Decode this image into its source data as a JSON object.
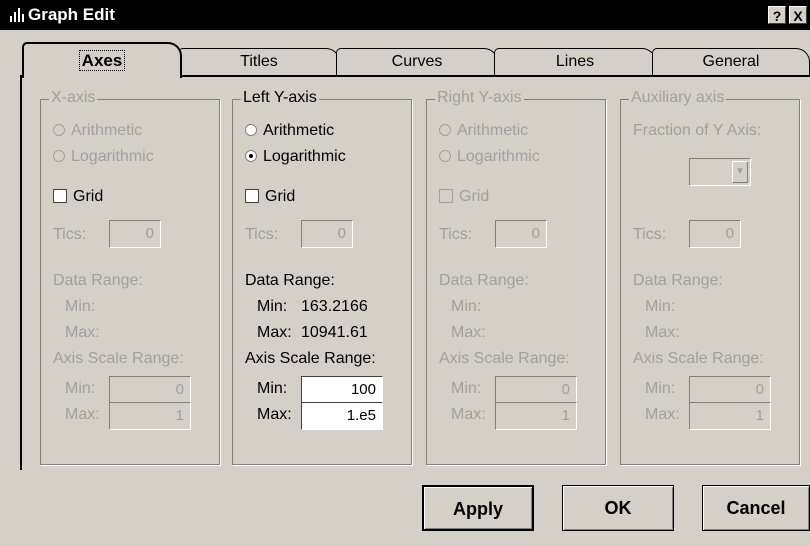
{
  "window": {
    "title": "Graph Edit",
    "help_label": "?",
    "close_label": "X"
  },
  "tabs": [
    {
      "label": "Axes",
      "active": true
    },
    {
      "label": "Titles"
    },
    {
      "label": "Curves"
    },
    {
      "label": "Lines"
    },
    {
      "label": "General"
    }
  ],
  "groups": {
    "x_axis": {
      "title": "X-axis",
      "arithmetic": "Arithmetic",
      "logarithmic": "Logarithmic",
      "grid": "Grid",
      "tics_label": "Tics:",
      "tics_value": "0",
      "data_range": "Data Range:",
      "min_label": "Min:",
      "max_label": "Max:",
      "scale_range": "Axis Scale Range:",
      "scale_min_label": "Min:",
      "scale_min": "0",
      "scale_max_label": "Max:",
      "scale_max": "1"
    },
    "left_y": {
      "title": "Left Y-axis",
      "arithmetic": "Arithmetic",
      "logarithmic": "Logarithmic",
      "grid": "Grid",
      "tics_label": "Tics:",
      "tics_value": "0",
      "data_range": "Data Range:",
      "min_label": "Min:",
      "min_value": "163.2166",
      "max_label": "Max:",
      "max_value": "10941.61",
      "scale_range": "Axis Scale Range:",
      "scale_min_label": "Min:",
      "scale_min": "100",
      "scale_max_label": "Max:",
      "scale_max": "1.e5"
    },
    "right_y": {
      "title": "Right Y-axis",
      "arithmetic": "Arithmetic",
      "logarithmic": "Logarithmic",
      "grid": "Grid",
      "tics_label": "Tics:",
      "tics_value": "0",
      "data_range": "Data Range:",
      "min_label": "Min:",
      "max_label": "Max:",
      "scale_range": "Axis Scale Range:",
      "scale_min_label": "Min:",
      "scale_min": "0",
      "scale_max_label": "Max:",
      "scale_max": "1"
    },
    "aux": {
      "title": "Auxiliary axis",
      "fraction_label": "Fraction of Y Axis:",
      "tics_label": "Tics:",
      "tics_value": "0",
      "data_range": "Data Range:",
      "min_label": "Min:",
      "max_label": "Max:",
      "scale_range": "Axis Scale Range:",
      "scale_min_label": "Min:",
      "scale_min": "0",
      "scale_max_label": "Max:",
      "scale_max": "1"
    }
  },
  "buttons": {
    "apply": "Apply",
    "ok": "OK",
    "cancel": "Cancel"
  }
}
